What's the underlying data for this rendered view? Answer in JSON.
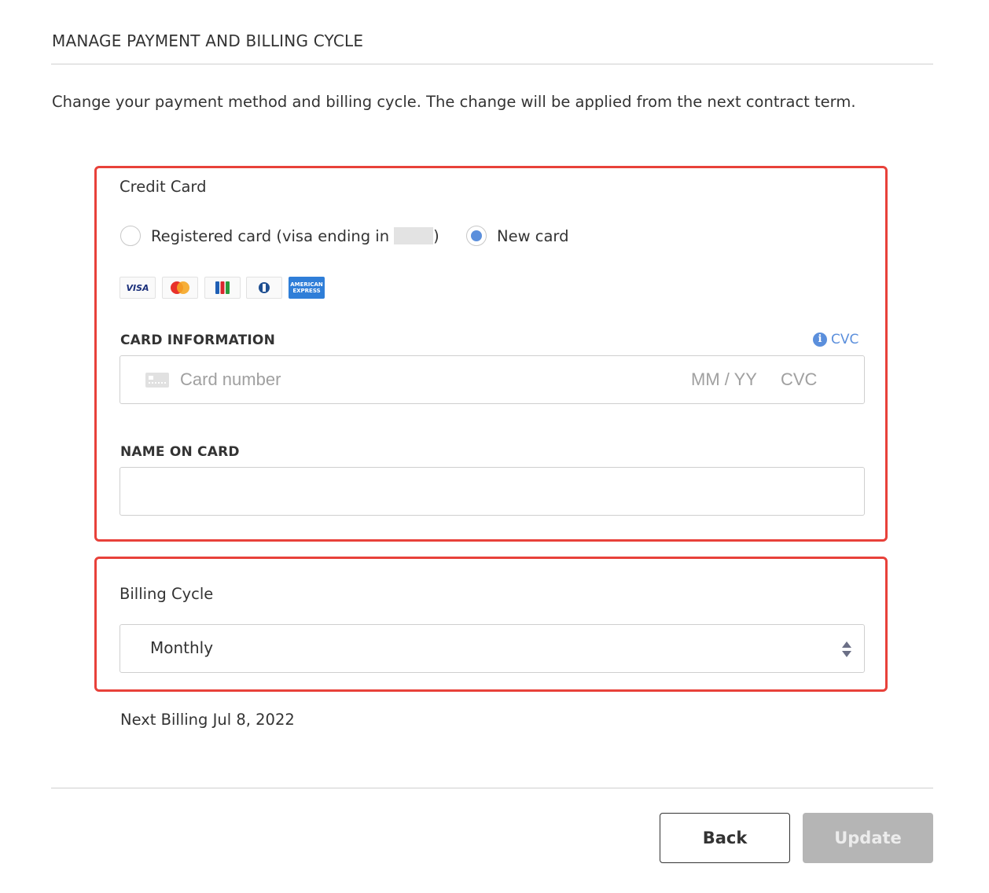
{
  "header": {
    "title": "MANAGE PAYMENT AND BILLING CYCLE",
    "description": "Change your payment method and billing cycle. The change will be applied from the next contract term."
  },
  "credit_card": {
    "section_title": "Credit Card",
    "options": [
      {
        "label": "Registered card (visa ending in",
        "suffix": ")",
        "selected": false,
        "masked": true
      },
      {
        "label": "New card",
        "selected": true
      }
    ],
    "brands": [
      "VISA",
      "MasterCard",
      "JCB",
      "Diners Club",
      "American Express"
    ],
    "card_information_label": "CARD INFORMATION",
    "cvc_help_label": "CVC",
    "card_number_placeholder": "Card number",
    "expiry_placeholder": "MM / YY",
    "cvc_placeholder": "CVC",
    "name_on_card_label": "NAME ON CARD",
    "name_on_card_value": ""
  },
  "billing_cycle": {
    "section_title": "Billing Cycle",
    "selected": "Monthly"
  },
  "next_billing": "Next Billing Jul 8, 2022",
  "buttons": {
    "back": "Back",
    "update": "Update"
  },
  "colors": {
    "highlight_border": "#e8413a",
    "accent_blue": "#5b8fdc",
    "disabled_button": "#b5b5b5"
  }
}
